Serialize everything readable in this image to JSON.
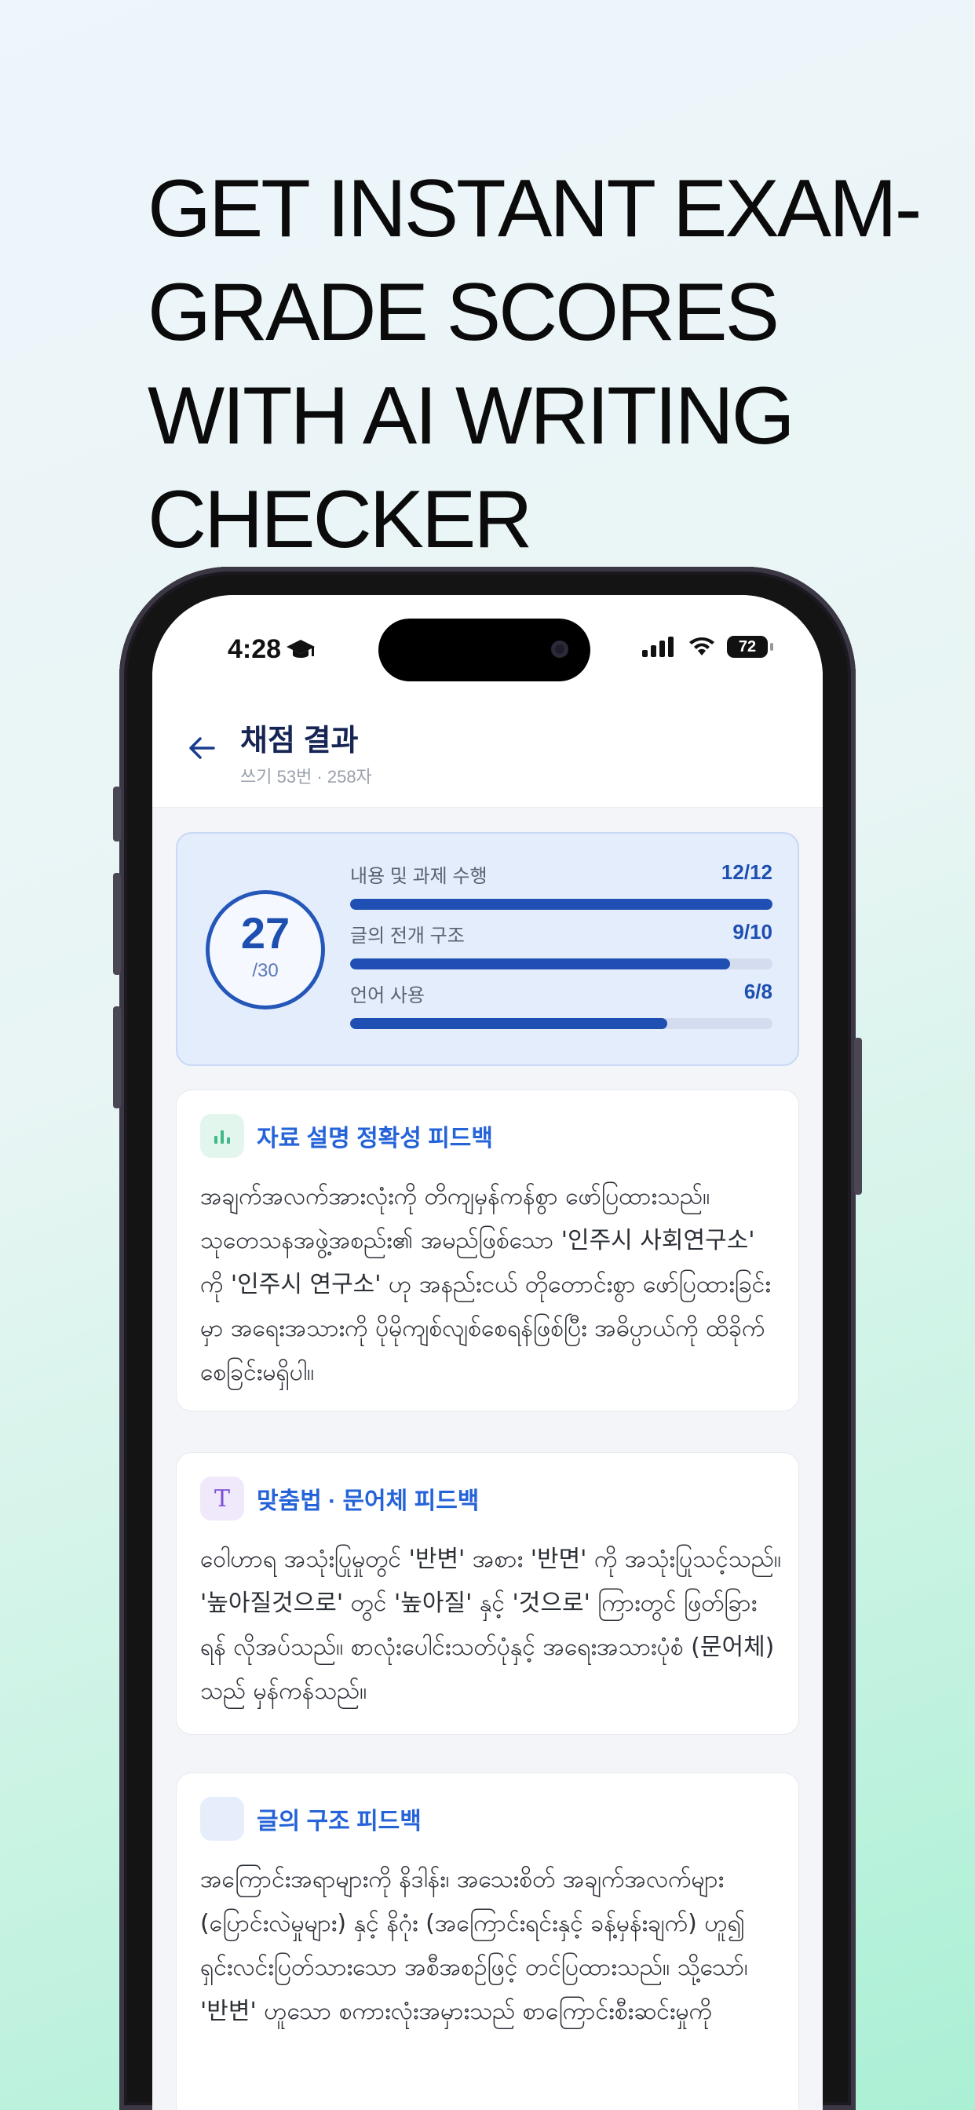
{
  "headline": [
    "GET INSTANT EXAM-",
    "GRADE SCORES",
    "WITH AI WRITING",
    "CHECKER"
  ],
  "status": {
    "time": "4:28",
    "battery": "72"
  },
  "header": {
    "title": "채점 결과",
    "subtitle": "쓰기 53번 · 258자",
    "back_icon": "arrow-left-icon"
  },
  "score": {
    "total": "27",
    "max": "/30",
    "criteria": [
      {
        "label": "내용 및 과제 수행",
        "score": "12/12",
        "fraction": 1.0
      },
      {
        "label": "글의 전개 구조",
        "score": "9/10",
        "fraction": 0.9
      },
      {
        "label": "언어 사용",
        "score": "6/8",
        "fraction": 0.75
      }
    ]
  },
  "feedback": [
    {
      "icon": "bar-chart-icon",
      "title": "자료 설명 정확성 피드백",
      "body": "အချက်အလက်အားလုံးကို တိကျမှန်ကန်စွာ ဖော်ပြထားသည်။ သုတေသနအဖွဲ့အစည်း၏ အမည်ဖြစ်သော '인주시 사회연구소' ကို '인주시 연구소' ဟု အနည်းငယ် တိုတောင်းစွာ ဖော်ပြထားခြင်းမှာ အရေးအသားကို ပိုမိုကျစ်လျစ်စေရန်ဖြစ်ပြီး အဓိပ္ပာယ်ကို ထိခိုက်စေခြင်းမရှိပါ။"
    },
    {
      "icon": "text-t-icon",
      "title": "맞춤법 · 문어체 피드백",
      "body": "ဝေါဟာရ အသုံးပြုမှုတွင် '반변' အစား '반면' ကို အသုံးပြုသင့်သည်။ '높아질것으로' တွင် '높아질' နှင့် '것으로' ကြားတွင် ဖြတ်ခြားရန် လိုအပ်သည်။ စာလုံးပေါင်းသတ်ပုံနှင့် အရေးအသားပုံစံ (문어체) သည် မှန်ကန်သည်။"
    },
    {
      "icon": "structure-icon",
      "title": "글의 구조 피드백",
      "body": "အကြောင်းအရာများကို နိဒါန်း၊ အသေးစိတ် အချက်အလက်များ (ပြောင်းလဲမှုများ) နှင့် နိဂုံး (အကြောင်းရင်းနှင့် ခန့်မှန်းချက်) ဟူ၍ ရှင်းလင်းပြတ်သားသော အစီအစဉ်ဖြင့် တင်ပြထားသည်။ သို့သော်၊ '반변' ဟူသော စကားလုံးအမှားသည် စာကြောင်းစီးဆင်းမှုကို"
    }
  ]
}
